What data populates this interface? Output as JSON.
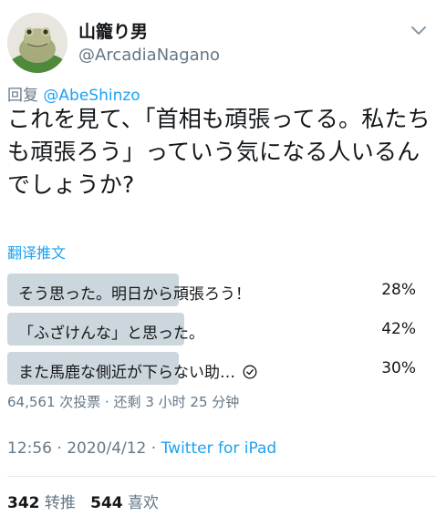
{
  "author": {
    "display_name": "山籠り男",
    "handle": "@ArcadiaNagano"
  },
  "reply": {
    "prefix": "回复",
    "mention": "@AbeShinzo"
  },
  "tweet": {
    "text": "これを見て、「首相も頑張ってる。私たちも頑張ろう」っていう気になる人いるんでしょうか?",
    "translate_link": "翻译推文"
  },
  "poll": {
    "options": [
      {
        "label": "そう思った。明日から頑張ろう！",
        "percent": "28%",
        "value": 28,
        "selected": false
      },
      {
        "label": "「ふざけんな」と思った。",
        "percent": "42%",
        "value": 42,
        "selected": false
      },
      {
        "label": "また馬鹿な側近が下らない助…",
        "percent": "30%",
        "value": 30,
        "selected": true
      }
    ],
    "meta": "64,561 次投票 · 还剩 3 小时 25 分钟"
  },
  "timestamp": {
    "time_date": "12:56 · 2020/4/12 · ",
    "source": "Twitter for iPad"
  },
  "stats": {
    "retweets_count": "342",
    "retweets_label": "转推",
    "likes_count": "544",
    "likes_label": "喜欢"
  },
  "colors": {
    "accent": "#1da1f2",
    "secondary_text": "#657786",
    "poll_bar": "#ccd6dd"
  },
  "icons": {
    "chevron": "chevron-down-icon",
    "check": "check-circle-icon"
  }
}
